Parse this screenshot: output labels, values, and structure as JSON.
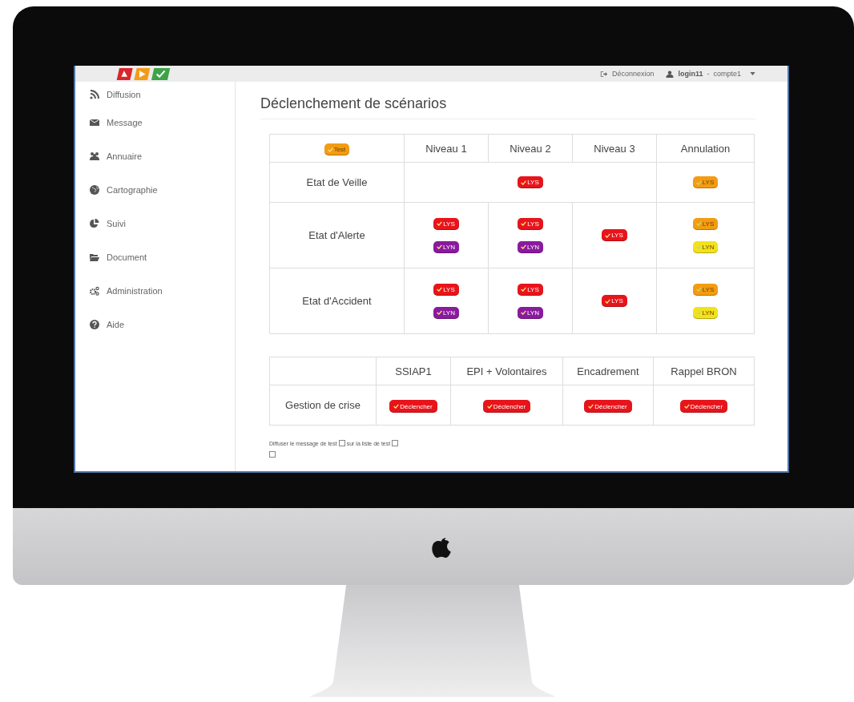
{
  "topbar": {
    "logout": "Déconnexion",
    "user": {
      "login": "login11",
      "separator": "-",
      "account": "compte1"
    }
  },
  "sidebar": {
    "items": [
      {
        "label": "Diffusion"
      },
      {
        "label": "Message"
      },
      {
        "label": "Annuaire"
      },
      {
        "label": "Cartographie"
      },
      {
        "label": "Suivi"
      },
      {
        "label": "Document"
      },
      {
        "label": "Administration"
      },
      {
        "label": "Aide"
      }
    ]
  },
  "page_title": "Déclenchement de scénarios",
  "scenario_table": {
    "corner_badge": {
      "label": "Test",
      "color": "#f39c12"
    },
    "columns": [
      "Niveau 1",
      "Niveau 2",
      "Niveau 3",
      "Annulation"
    ],
    "rows": [
      {
        "label": "Etat de Veille",
        "cells": [
          {
            "colspan": 3,
            "badges": [
              {
                "label": "LYS",
                "color": "#e8141b"
              }
            ]
          },
          {
            "badges": [
              {
                "label": "LYS",
                "color": "#f39c12"
              }
            ]
          }
        ]
      },
      {
        "label": "Etat d'Alerte",
        "cells": [
          {
            "badges": [
              {
                "label": "LYS",
                "color": "#e8141b"
              },
              {
                "label": "LYN",
                "color": "#8a1a9e"
              }
            ]
          },
          {
            "badges": [
              {
                "label": "LYS",
                "color": "#e8141b"
              },
              {
                "label": "LYN",
                "color": "#8a1a9e"
              }
            ]
          },
          {
            "badges": [
              {
                "label": "LYS",
                "color": "#e8141b"
              }
            ]
          },
          {
            "badges": [
              {
                "label": "LYS",
                "color": "#f39c12"
              },
              {
                "label": "LYN",
                "color": "#f2e21c"
              }
            ]
          }
        ]
      },
      {
        "label": "Etat d'Accident",
        "cells": [
          {
            "badges": [
              {
                "label": "LYS",
                "color": "#e8141b"
              },
              {
                "label": "LYN",
                "color": "#8a1a9e"
              }
            ]
          },
          {
            "badges": [
              {
                "label": "LYS",
                "color": "#e8141b"
              },
              {
                "label": "LYN",
                "color": "#8a1a9e"
              }
            ]
          },
          {
            "badges": [
              {
                "label": "LYS",
                "color": "#e8141b"
              }
            ]
          },
          {
            "badges": [
              {
                "label": "LYS",
                "color": "#f39c12"
              },
              {
                "label": "LYN",
                "color": "#f2e21c"
              }
            ]
          }
        ]
      }
    ]
  },
  "crisis_table": {
    "columns": [
      "SSIAP1",
      "EPI + Volontaires",
      "Encadrement",
      "Rappel BRON"
    ],
    "rows": [
      {
        "label": "Gestion de crise",
        "buttons": [
          {
            "label": "Déclencher",
            "color": "#e8141b"
          },
          {
            "label": "Déclencher",
            "color": "#e8141b"
          },
          {
            "label": "Déclencher",
            "color": "#e8141b"
          },
          {
            "label": "Déclencher",
            "color": "#e8141b"
          }
        ]
      }
    ]
  },
  "test_options": {
    "text_1": "Diffuser le message de test",
    "checkbox_1": {
      "checked": false
    },
    "text_2": "sur la liste de test",
    "checkbox_2": {
      "checked": false
    },
    "checkbox_3": {
      "checked": false
    }
  }
}
